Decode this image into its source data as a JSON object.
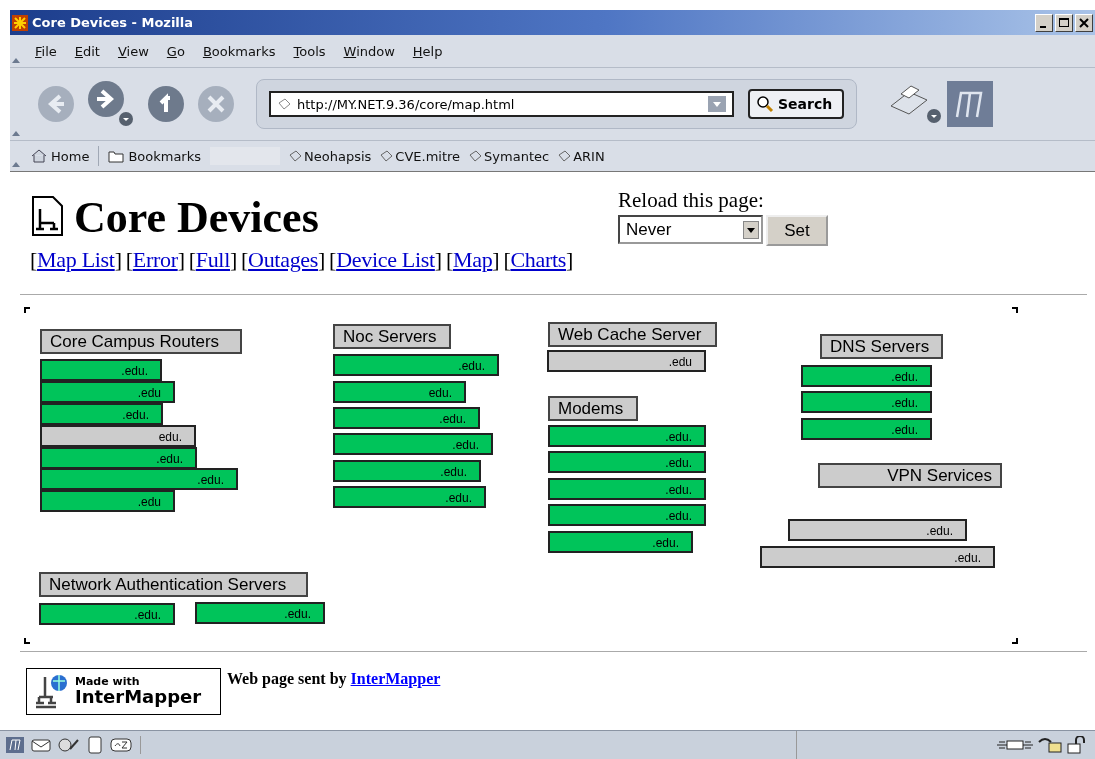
{
  "window": {
    "title": "Core Devices - Mozilla"
  },
  "menu": [
    "File",
    "Edit",
    "View",
    "Go",
    "Bookmarks",
    "Tools",
    "Window",
    "Help"
  ],
  "navigation": {
    "url": "http://MY.NET.9.36/core/map.html",
    "search_button": "Search"
  },
  "bookmarks": [
    {
      "kind": "home",
      "label": "Home"
    },
    {
      "kind": "folder",
      "label": "Bookmarks"
    },
    {
      "kind": "link",
      "label": "Neohapsis"
    },
    {
      "kind": "link",
      "label": "CVE.mitre"
    },
    {
      "kind": "link",
      "label": "Symantec"
    },
    {
      "kind": "link",
      "label": "ARIN"
    }
  ],
  "page": {
    "title": "Core Devices",
    "links": [
      {
        "open": "[",
        "label": "Map List",
        "close": "]"
      },
      {
        "open": "[",
        "label": "Error",
        "close": "]"
      },
      {
        "open": "[",
        "label": "Full",
        "close": "]"
      },
      {
        "open": "[",
        "label": "Outages",
        "close": "]"
      },
      {
        "open": "[",
        "label": "Device List",
        "close": "]"
      },
      {
        "open": "[",
        "label": "Map",
        "close": "]"
      },
      {
        "open": "[",
        "label": "Charts",
        "close": "]"
      }
    ],
    "reload": {
      "label": "Reload this page:",
      "value": "Never",
      "button": "Set"
    }
  },
  "map": {
    "groups": [
      {
        "title": "Core Campus Routers",
        "devices": [
          {
            "label": ".edu.",
            "color": "#00c45a"
          },
          {
            "label": ".edu",
            "color": "#00c45a"
          },
          {
            "label": ".edu.",
            "color": "#00c45a"
          },
          {
            "label": "edu.",
            "color": "#cccccc"
          },
          {
            "label": ".edu.",
            "color": "#00c45a"
          },
          {
            "label": ".edu.",
            "color": "#00c45a"
          },
          {
            "label": ".edu",
            "color": "#00c45a"
          }
        ]
      },
      {
        "title": "Noc Servers",
        "devices": [
          {
            "label": ".edu.",
            "color": "#00c45a"
          },
          {
            "label": "edu.",
            "color": "#00c45a"
          },
          {
            "label": ".edu.",
            "color": "#00c45a"
          },
          {
            "label": ".edu.",
            "color": "#00c45a"
          },
          {
            "label": ".edu.",
            "color": "#00c45a"
          },
          {
            "label": ".edu.",
            "color": "#00c45a"
          }
        ]
      },
      {
        "title": "Web Cache Server",
        "devices": [
          {
            "label": ".edu",
            "color": "#cccccc"
          }
        ]
      },
      {
        "title": "Modems",
        "devices": [
          {
            "label": ".edu.",
            "color": "#00c45a"
          },
          {
            "label": ".edu.",
            "color": "#00c45a"
          },
          {
            "label": ".edu.",
            "color": "#00c45a"
          },
          {
            "label": ".edu.",
            "color": "#00c45a"
          },
          {
            "label": ".edu.",
            "color": "#00c45a"
          }
        ]
      },
      {
        "title": "DNS Servers",
        "devices": [
          {
            "label": ".edu.",
            "color": "#00c45a"
          },
          {
            "label": ".edu.",
            "color": "#00c45a"
          },
          {
            "label": ".edu.",
            "color": "#00c45a"
          }
        ]
      },
      {
        "title": "VPN Services",
        "devices": [
          {
            "label": ".edu.",
            "color": "#cccccc"
          },
          {
            "label": ".edu.",
            "color": "#cccccc"
          }
        ]
      },
      {
        "title": "Network Authentication Servers",
        "devices": [
          {
            "label": ".edu.",
            "color": "#00c45a"
          },
          {
            "label": ".edu.",
            "color": "#00c45a"
          }
        ]
      }
    ]
  },
  "footer": {
    "badge_top": "Made with",
    "badge_bottom": "InterMapper",
    "text": "Web page sent by",
    "link": "InterMapper"
  }
}
